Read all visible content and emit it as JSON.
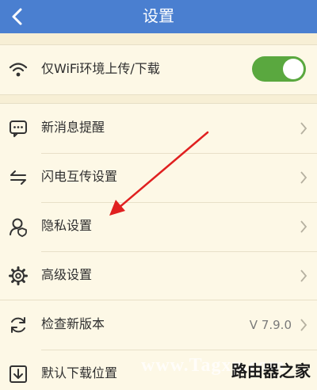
{
  "header": {
    "title": "设置"
  },
  "groups": {
    "network": {
      "items": [
        {
          "label": "仅WiFi环境上传/下载",
          "icon": "wifi-icon",
          "toggle": true
        }
      ]
    },
    "main": {
      "items": [
        {
          "label": "新消息提醒",
          "icon": "message-icon"
        },
        {
          "label": "闪电互传设置",
          "icon": "transfer-icon"
        },
        {
          "label": "隐私设置",
          "icon": "privacy-icon"
        },
        {
          "label": "高级设置",
          "icon": "gear-icon"
        }
      ]
    },
    "other": {
      "items": [
        {
          "label": "检查新版本",
          "icon": "refresh-icon",
          "value": "V 7.9.0"
        },
        {
          "label": "默认下载位置",
          "icon": "download-icon"
        }
      ]
    }
  },
  "watermark": {
    "text": "www.Tagxp.com",
    "cn": "路由器之家"
  },
  "colors": {
    "header": "#4a7fd0",
    "toggle_on": "#5aa83f",
    "arrow": "#e02020",
    "background": "#fbf5e0"
  }
}
